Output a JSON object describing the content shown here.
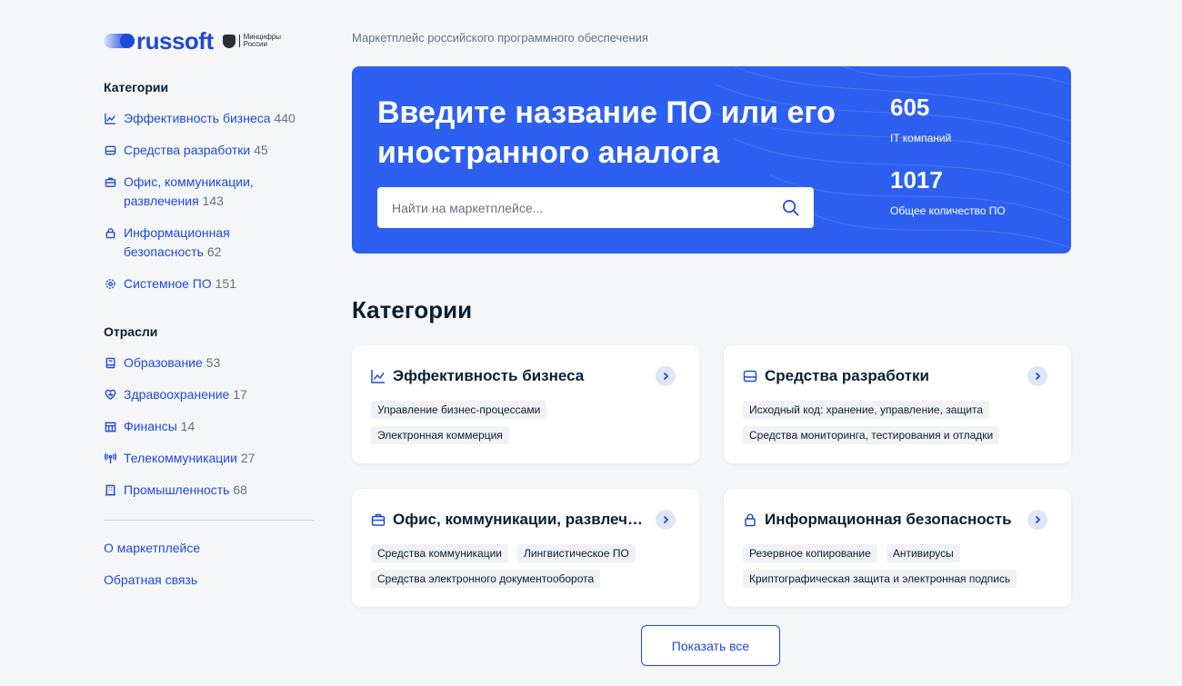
{
  "logo": {
    "brand": "russoft",
    "ministry_line1": "Минцифры",
    "ministry_line2": "России"
  },
  "sidebar": {
    "categories_title": "Категории",
    "categories": [
      {
        "label": "Эффективность бизнеса",
        "count": "440",
        "icon": "chart-line-icon"
      },
      {
        "label": "Средства разработки",
        "count": "45",
        "icon": "dev-tools-icon"
      },
      {
        "label": "Офис, коммуникации, развлечения",
        "count": "143",
        "icon": "briefcase-icon"
      },
      {
        "label": "Информационная безопасность",
        "count": "62",
        "icon": "lock-icon"
      },
      {
        "label": "Системное ПО",
        "count": "151",
        "icon": "gear-icon"
      }
    ],
    "industries_title": "Отрасли",
    "industries": [
      {
        "label": "Образование",
        "count": "53",
        "icon": "book-icon"
      },
      {
        "label": "Здравоохранение",
        "count": "17",
        "icon": "heart-icon"
      },
      {
        "label": "Финансы",
        "count": "14",
        "icon": "bank-icon"
      },
      {
        "label": "Телекоммуникации",
        "count": "27",
        "icon": "antenna-icon"
      },
      {
        "label": "Промышленность",
        "count": "68",
        "icon": "building-icon"
      }
    ],
    "links": [
      "О маркетплейсе",
      "Обратная связь"
    ]
  },
  "main": {
    "subtitle": "Маркетплейс российского программного обеспечения",
    "hero": {
      "title": "Введите название ПО или его иностранного аналога",
      "search_placeholder": "Найти на маркетплейсе...",
      "stats": [
        {
          "value": "605",
          "label": "IT компаний"
        },
        {
          "value": "1017",
          "label": "Общее количество ПО"
        }
      ]
    },
    "categories_heading": "Категории",
    "cards": [
      {
        "title": "Эффективность бизнеса",
        "icon": "chart-line-icon",
        "tags": [
          "Управление бизнес-процессами",
          "Электронная коммерция"
        ]
      },
      {
        "title": "Средства разработки",
        "icon": "dev-tools-icon",
        "tags": [
          "Исходный код: хранение, управление, защита",
          "Средства мониторинга, тестирования и отладки"
        ]
      },
      {
        "title": "Офис, коммуникации, развлечения",
        "icon": "briefcase-icon",
        "tags": [
          "Средства коммуникации",
          "Лингвистическое ПО",
          "Средства электронного документооборота"
        ]
      },
      {
        "title": "Информационная безопасность",
        "icon": "lock-icon",
        "tags": [
          "Резервное копирование",
          "Антивирусы",
          "Криптографическая защита и электронная подпись"
        ]
      }
    ],
    "show_all_label": "Показать все"
  },
  "colors": {
    "accent": "#1f49d8",
    "hero": "#2d5ff0",
    "background": "#f5f6f8"
  }
}
